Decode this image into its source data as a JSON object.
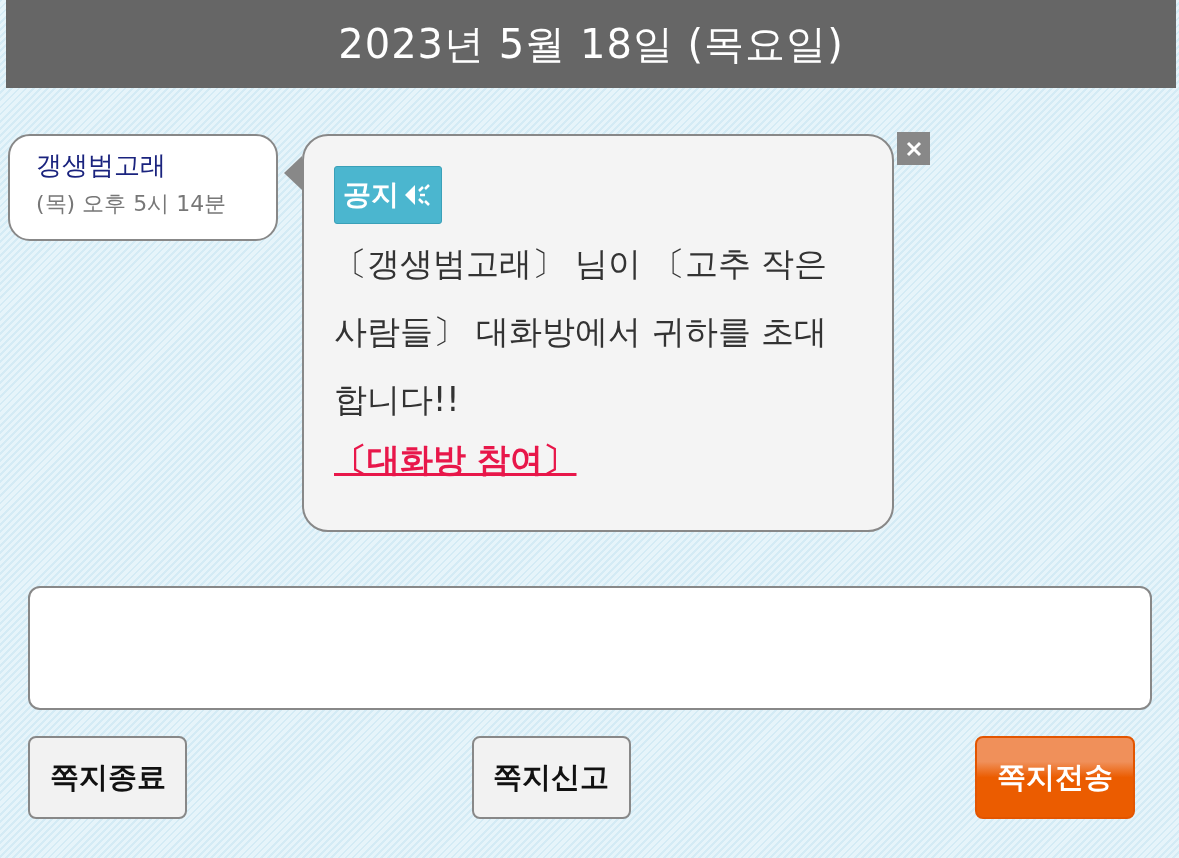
{
  "date_header": "2023년 5월 18일 (목요일)",
  "sender": {
    "name": "갱생범고래",
    "time": "(목) 오후 5시 14분"
  },
  "message": {
    "badge": "공지",
    "text": "〔갱생범고래〕 님이 〔고추 작은 사람들〕 대화방에서 귀하를 초대합니다!!",
    "link": "〔대화방 참여〕"
  },
  "buttons": [
    {
      "label": "쪽지종료",
      "kind": "plain"
    },
    {
      "label": "쪽지신고",
      "kind": "plain"
    },
    {
      "label": "쪽지전송",
      "kind": "primary"
    }
  ]
}
